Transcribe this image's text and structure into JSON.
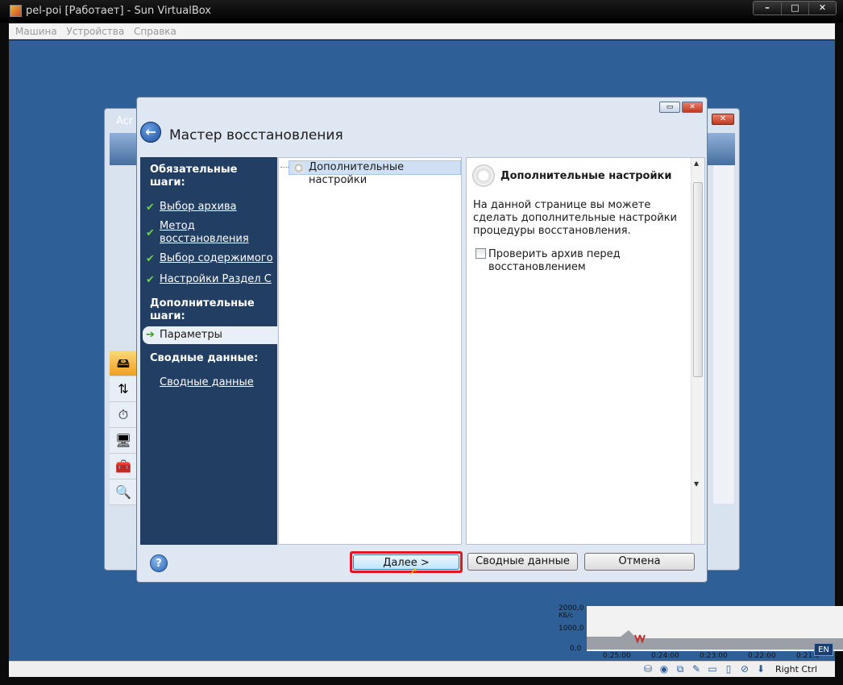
{
  "vbox": {
    "title": "pel-poi [Работает] - Sun VirtualBox",
    "menu": [
      "Машина",
      "Устройства",
      "Справка"
    ],
    "status_key": "Right Ctrl",
    "lang": "EN",
    "graph": {
      "y_labels": [
        "2000,0",
        "КБ/с",
        "1000,0",
        "0,0"
      ],
      "x_labels": [
        "0:25:00",
        "0:24:00",
        "0:23:00",
        "0:22:00",
        "0:21:0"
      ]
    }
  },
  "bgwin": {
    "title": "Acr"
  },
  "wizard": {
    "title": "Мастер восстановления",
    "nav": {
      "required_header": "Обязательные шаги:",
      "required_items": [
        "Выбор архива",
        "Метод восстановления",
        "Выбор содержимого",
        "Настройки Раздел C"
      ],
      "optional_header": "Дополнительные шаги:",
      "current_item": "Параметры",
      "summary_header": "Сводные данные:",
      "summary_item": "Сводные данные"
    },
    "tree_item": "Дополнительные настройки",
    "detail": {
      "heading": "Дополнительные настройки",
      "description": "На данной странице вы можете сделать дополнительные настройки процедуры восстановления.",
      "checkbox_label": "Проверить архив перед восстановлением",
      "checkbox_checked": false
    },
    "buttons": {
      "next": "Далее >",
      "summary": "Сводные данные",
      "cancel": "Отмена"
    },
    "help": "?"
  }
}
